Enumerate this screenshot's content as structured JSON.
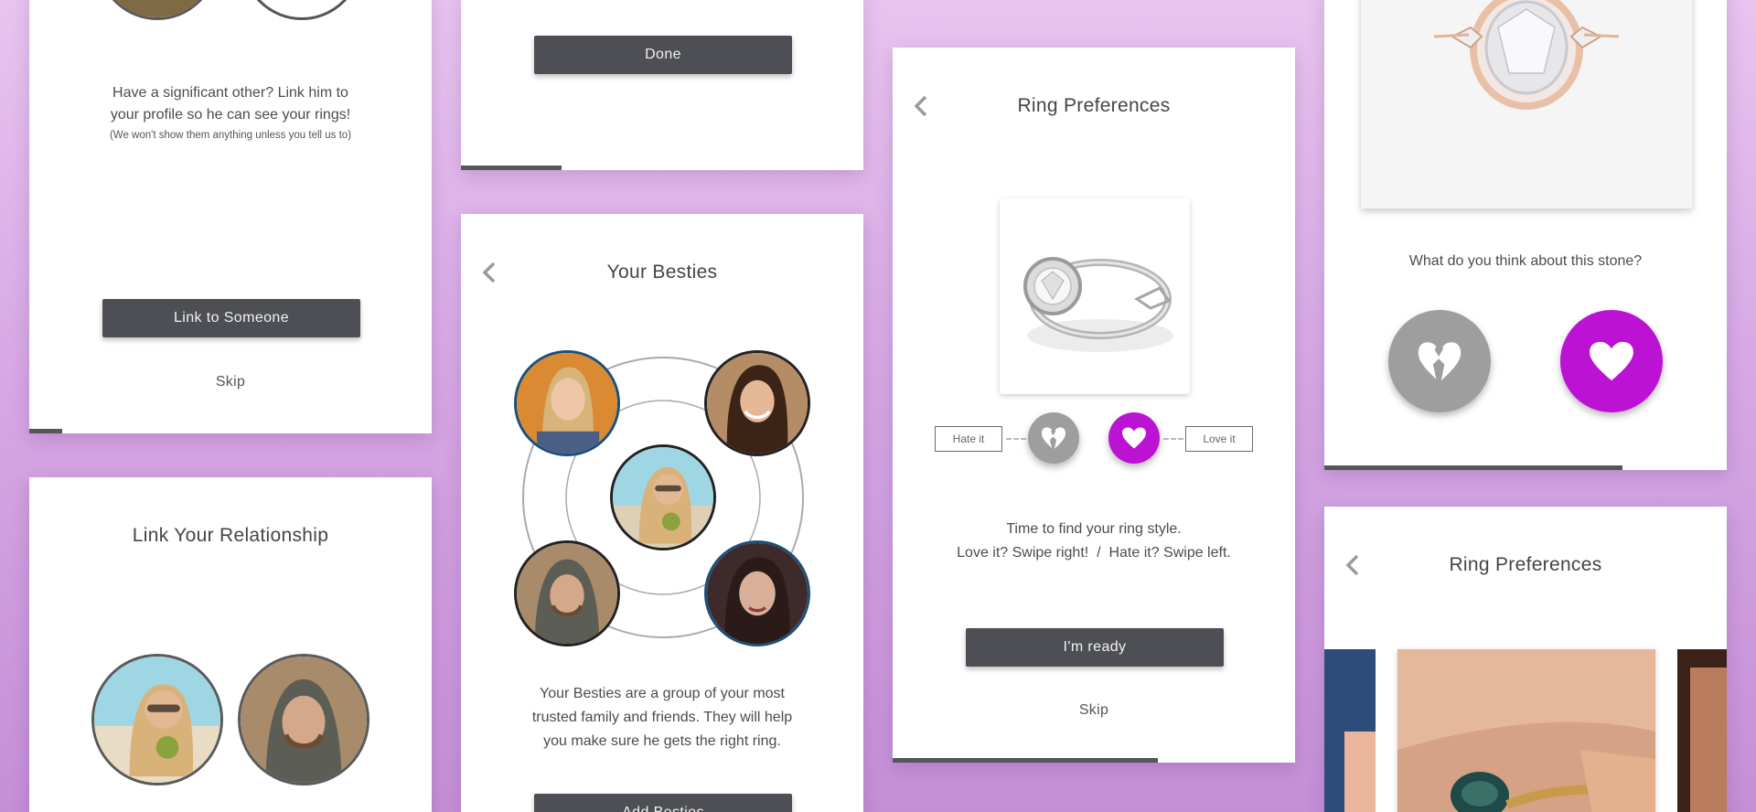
{
  "link_card": {
    "body_line1": "Have a significant other? Link him to",
    "body_line2": "your profile so he can see your rings!",
    "body_small": "(We won't show them anything unless you tell us to)",
    "link_button": "Link to Someone",
    "skip": "Skip",
    "progress": 0.08
  },
  "relationship_card": {
    "title": "Link Your Relationship"
  },
  "done_card": {
    "done_button": "Done",
    "progress": 0.25
  },
  "besties_card": {
    "title": "Your Besties",
    "body_line1": "Your Besties are a group of your most",
    "body_line2": "trusted family and friends. They will help",
    "body_line3": "you make sure he gets the right ring.",
    "add_button": "Add Besties"
  },
  "ring_pref_card": {
    "title": "Ring Preferences",
    "hate_label": "Hate it",
    "love_label": "Love it",
    "body_line1": "Time to find your ring style.",
    "body_line2": "Love it? Swipe right!  /  Hate it? Swipe left.",
    "ready_button": "I'm ready",
    "skip": "Skip",
    "progress": 0.66
  },
  "stone_card": {
    "question": "What do you think about this stone?",
    "progress": 0.75
  },
  "ring_pref_card_2": {
    "title": "Ring Preferences"
  },
  "colors": {
    "accent": "#bb12d4",
    "dark_button": "#4d4f55",
    "dislike_grey": "#9e9e9e"
  },
  "icons": [
    "chevron-left-icon",
    "broken-heart-icon",
    "heart-icon"
  ]
}
